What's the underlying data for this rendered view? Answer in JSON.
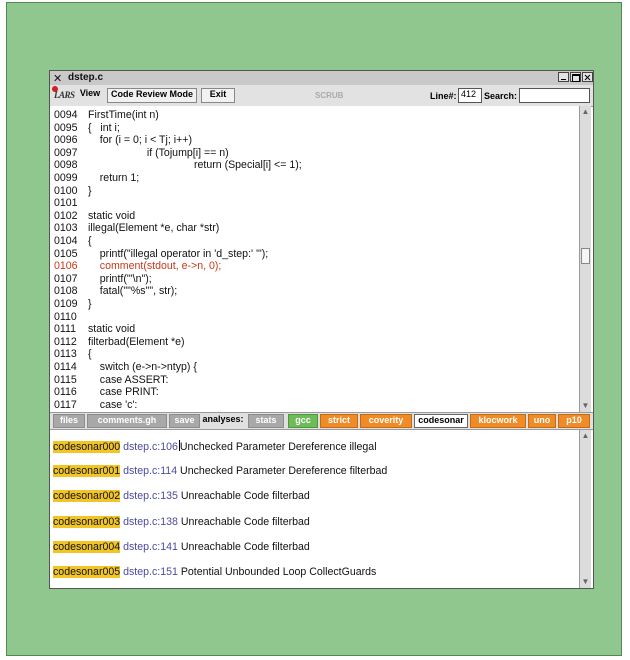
{
  "window": {
    "title": "dstep.c"
  },
  "toolbar": {
    "logo": "LARS",
    "view_label": "View",
    "code_review_label": "Code Review Mode",
    "exit_label": "Exit",
    "scrub_label": "SCRUB",
    "line_label": "Line#:",
    "line_value": "412",
    "search_label": "Search:",
    "search_value": ""
  },
  "code": {
    "lines": [
      {
        "num": "0094",
        "text": "FirstTime(int n)",
        "highlight": false
      },
      {
        "num": "0095",
        "text": "{   int i;",
        "highlight": false
      },
      {
        "num": "0096",
        "text": "    for (i = 0; i < Tj; i++)",
        "highlight": false
      },
      {
        "num": "0097",
        "text": "                    if (Tojump[i] == n)",
        "highlight": false
      },
      {
        "num": "0098",
        "text": "                                    return (Special[i] <= 1);",
        "highlight": false
      },
      {
        "num": "0099",
        "text": "    return 1;",
        "highlight": false
      },
      {
        "num": "0100",
        "text": "}",
        "highlight": false
      },
      {
        "num": "0101",
        "text": "",
        "highlight": false
      },
      {
        "num": "0102",
        "text": "static void",
        "highlight": false
      },
      {
        "num": "0103",
        "text": "illegal(Element *e, char *str)",
        "highlight": false
      },
      {
        "num": "0104",
        "text": "{",
        "highlight": false
      },
      {
        "num": "0105",
        "text": "    printf(\"illegal operator in 'd_step:' '\");",
        "highlight": false
      },
      {
        "num": "0106",
        "text": "    comment(stdout, e->n, 0);",
        "highlight": true
      },
      {
        "num": "0107",
        "text": "    printf(\"'\\n\");",
        "highlight": false
      },
      {
        "num": "0108",
        "text": "    fatal(\"\"%s\"\", str);",
        "highlight": false
      },
      {
        "num": "0109",
        "text": "}",
        "highlight": false
      },
      {
        "num": "0110",
        "text": "",
        "highlight": false
      },
      {
        "num": "0111",
        "text": "static void",
        "highlight": false
      },
      {
        "num": "0112",
        "text": "filterbad(Element *e)",
        "highlight": false
      },
      {
        "num": "0113",
        "text": "{",
        "highlight": false
      },
      {
        "num": "0114",
        "text": "    switch (e->n->ntyp) {",
        "highlight": false
      },
      {
        "num": "0115",
        "text": "    case ASSERT:",
        "highlight": false
      },
      {
        "num": "0116",
        "text": "    case PRINT:",
        "highlight": false
      },
      {
        "num": "0117",
        "text": "    case 'c':",
        "highlight": false
      }
    ]
  },
  "analyses_bar": {
    "files_label": "files",
    "comments_label": "comments.gh",
    "save_label": "save",
    "analyses_label": "analyses:",
    "tools": [
      {
        "label": "stats",
        "style": "grey"
      },
      {
        "label": "gcc",
        "style": "green"
      },
      {
        "label": "strict",
        "style": "orange"
      },
      {
        "label": "coverity",
        "style": "orange"
      },
      {
        "label": "codesonar",
        "style": "selected"
      },
      {
        "label": "klocwork",
        "style": "orange"
      },
      {
        "label": "uno",
        "style": "orange"
      },
      {
        "label": "p10",
        "style": "orange"
      }
    ]
  },
  "results": [
    {
      "id": "codesonar000",
      "location": "dstep.c:106",
      "description": "Unchecked Parameter Dereference illegal"
    },
    {
      "id": "codesonar001",
      "location": "dstep.c:114",
      "description": "Unchecked Parameter Dereference filterbad"
    },
    {
      "id": "codesonar002",
      "location": "dstep.c:135",
      "description": "Unreachable Code filterbad"
    },
    {
      "id": "codesonar003",
      "location": "dstep.c:138",
      "description": "Unreachable Code filterbad"
    },
    {
      "id": "codesonar004",
      "location": "dstep.c:141",
      "description": "Unreachable Code filterbad"
    },
    {
      "id": "codesonar005",
      "location": "dstep.c:151",
      "description": "Potential Unbounded Loop CollectGuards"
    }
  ],
  "colors": {
    "background": "#8fc78f",
    "highlight_code": "#c8381a",
    "result_id_bg": "#f2c526",
    "result_location": "#4a4aa0",
    "tool_orange": "#f08c28",
    "tool_green": "#6fbb5a"
  },
  "icons": {
    "window_icon": "x-window-icon",
    "minimize": "minimize-icon",
    "maximize": "maximize-icon",
    "close": "close-icon",
    "scroll_up": "arrow-up-icon",
    "scroll_down": "arrow-down-icon"
  }
}
